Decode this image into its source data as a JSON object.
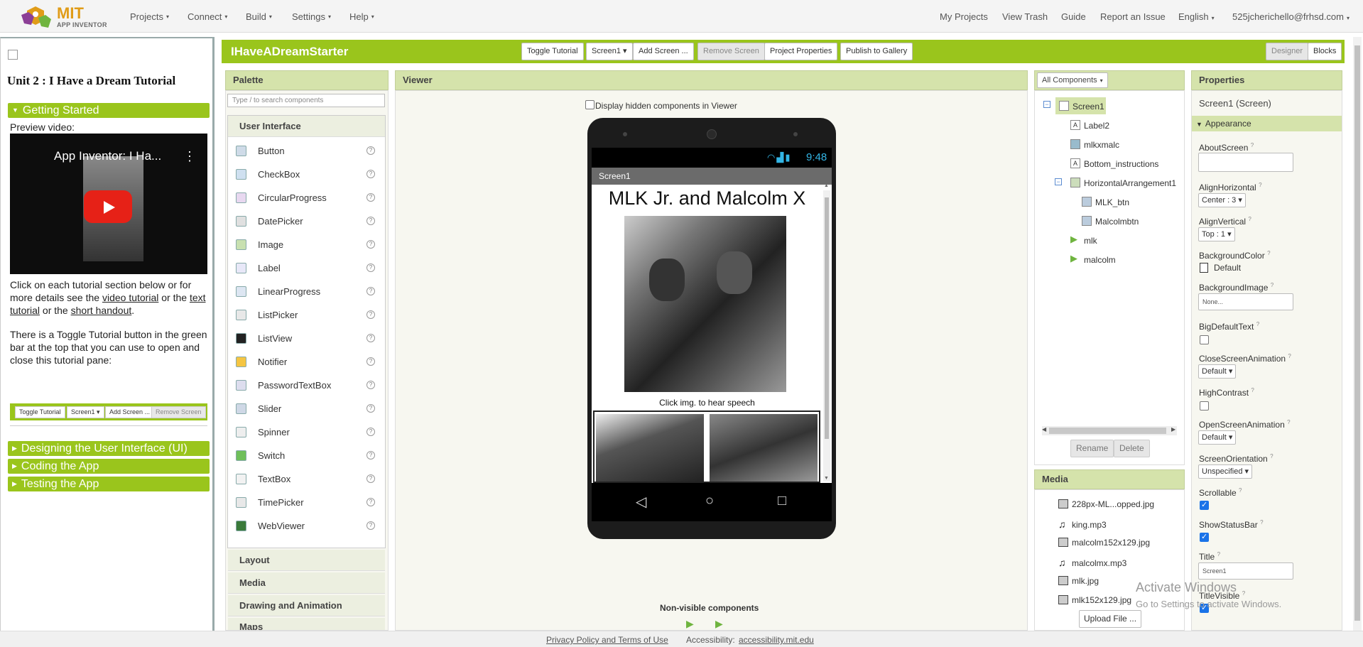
{
  "nav": {
    "logo_mit": "MIT",
    "logo_sub": "APP INVENTOR",
    "menus": [
      "Projects",
      "Connect",
      "Build",
      "Settings",
      "Help"
    ],
    "right": [
      "My Projects",
      "View Trash",
      "Guide",
      "Report an Issue",
      "English",
      "525jcherichello@frhsd.com"
    ]
  },
  "tutorial": {
    "title": "Unit 2 : I Have a Dream Tutorial",
    "section_getting_started": "Getting Started",
    "preview_video": "Preview video:",
    "video_title": "App Inventor: I Ha...",
    "para1_a": "Click on each tutorial section below or for more details see the ",
    "para1_link1": "video tutorial",
    "para1_b": " or the ",
    "para1_link2": "text tutorial",
    "para1_c": " or the ",
    "para1_link3": "short handout",
    "para1_d": ".",
    "para2": "There is a Toggle Tutorial button in the green bar at the top that you can use to open and close this tutorial pane:",
    "mini_buttons": [
      "Toggle Tutorial",
      "Screen1 ▾",
      "Add Screen ...",
      "Remove Screen"
    ],
    "sections": [
      "Designing the User Interface (UI)",
      "Coding the App",
      "Testing the App"
    ]
  },
  "project": {
    "name": "IHaveADreamStarter",
    "buttons": [
      "Toggle Tutorial",
      "Screen1 ▾",
      "Add Screen ...",
      "Remove Screen",
      "Project Properties",
      "Publish to Gallery"
    ],
    "designer": "Designer",
    "blocks": "Blocks"
  },
  "palette": {
    "header": "Palette",
    "search_placeholder": "Type / to search components",
    "category_ui": "User Interface",
    "items": [
      "Button",
      "CheckBox",
      "CircularProgress",
      "DatePicker",
      "Image",
      "Label",
      "LinearProgress",
      "ListPicker",
      "ListView",
      "Notifier",
      "PasswordTextBox",
      "Slider",
      "Spinner",
      "Switch",
      "TextBox",
      "TimePicker",
      "WebViewer"
    ],
    "categories": [
      "Layout",
      "Media",
      "Drawing and Animation",
      "Maps"
    ]
  },
  "viewer": {
    "header": "Viewer",
    "hidden_label": "Display hidden components in Viewer",
    "time": "9:48",
    "screen_title": "Screen1",
    "label_text": "MLK Jr. and Malcolm X",
    "caption": "Click img. to hear speech",
    "nonvisible": "Non-visible components"
  },
  "components": {
    "dropdown": "All Components",
    "tree": [
      "Screen1",
      "Label2",
      "mlkxmalc",
      "Bottom_instructions",
      "HorizontalArrangement1",
      "MLK_btn",
      "Malcolmbtn",
      "mlk",
      "malcolm"
    ],
    "rename": "Rename",
    "delete": "Delete"
  },
  "media": {
    "header": "Media",
    "files": [
      "228px-ML...opped.jpg",
      "king.mp3",
      "malcolm152x129.jpg",
      "malcolmx.mp3",
      "mlk.jpg",
      "mlk152x129.jpg"
    ],
    "upload": "Upload File ..."
  },
  "properties": {
    "header": "Properties",
    "subheader": "Screen1 (Screen)",
    "group": "Appearance",
    "about_screen": "AboutScreen",
    "align_horizontal": "AlignHorizontal",
    "align_horizontal_value": "Center : 3",
    "align_vertical": "AlignVertical",
    "align_vertical_value": "Top : 1",
    "background_color": "BackgroundColor",
    "background_color_value": "Default",
    "background_image": "BackgroundImage",
    "background_image_value": "None...",
    "big_default_text": "BigDefaultText",
    "close_anim": "CloseScreenAnimation",
    "close_anim_value": "Default",
    "high_contrast": "HighContrast",
    "open_anim": "OpenScreenAnimation",
    "open_anim_value": "Default",
    "orientation": "ScreenOrientation",
    "orientation_value": "Unspecified",
    "scrollable": "Scrollable",
    "show_status": "ShowStatusBar",
    "title": "Title",
    "title_value": "Screen1",
    "title_visible": "TitleVisible"
  },
  "footer": {
    "privacy": "Privacy Policy and Terms of Use",
    "accessibility_label": "Accessibility:",
    "accessibility_link": "accessibility.mit.edu"
  },
  "watermark": {
    "line1": "Activate Windows",
    "line2": "Go to Settings to activate Windows."
  },
  "colors": {
    "green": "#9ac51c",
    "panel": "#d5e3ab"
  }
}
